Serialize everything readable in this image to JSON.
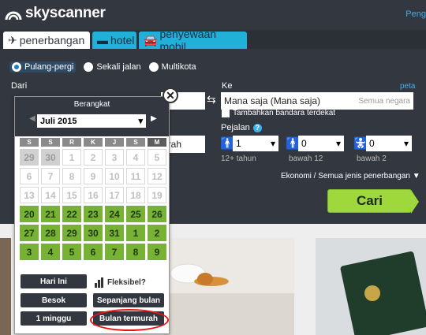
{
  "header": {
    "logo": "skyscanner",
    "top_link": "Peng"
  },
  "tabs": [
    {
      "label": "penerbangan",
      "icon": "plane-icon",
      "active": true
    },
    {
      "label": "hotel",
      "icon": "bed-icon",
      "active": false
    },
    {
      "label": "penyewaan mobil",
      "icon": "car-icon",
      "active": false
    }
  ],
  "trip_type": [
    {
      "label": "Pulang-pergi",
      "selected": true
    },
    {
      "label": "Sekali jalan",
      "selected": false
    },
    {
      "label": "Multikota",
      "selected": false
    }
  ],
  "form": {
    "from_label": "Dari",
    "to_label": "Ke",
    "map_link": "peta",
    "to_value": "Mana saja (Mana saja)",
    "to_placeholder": "Semua negara",
    "nearby_airports": "Tambahkan bandara terdekat",
    "return_value_fragment": "urah",
    "passengers_label": "Pejalan",
    "help": "?",
    "adults": {
      "value": "1",
      "note": "12+ tahun"
    },
    "children": {
      "value": "0",
      "note": "bawah 12"
    },
    "infants": {
      "value": "0",
      "note": "bawah 2"
    },
    "cabin": "Ekonomi / Semua jenis penerbangan ▼",
    "search_button": "Cari"
  },
  "calendar": {
    "title": "Berangkat",
    "month": "Juli 2015",
    "weekdays": [
      "S",
      "S",
      "R",
      "K",
      "J",
      "S",
      "M"
    ],
    "rows": [
      [
        {
          "d": "29",
          "s": "prev"
        },
        {
          "d": "30",
          "s": "prev"
        },
        {
          "d": "1",
          "s": "past"
        },
        {
          "d": "2",
          "s": "past"
        },
        {
          "d": "3",
          "s": "past"
        },
        {
          "d": "4",
          "s": "past"
        },
        {
          "d": "5",
          "s": "past"
        }
      ],
      [
        {
          "d": "6",
          "s": "past"
        },
        {
          "d": "7",
          "s": "past"
        },
        {
          "d": "8",
          "s": "past"
        },
        {
          "d": "9",
          "s": "past"
        },
        {
          "d": "10",
          "s": "past"
        },
        {
          "d": "11",
          "s": "past"
        },
        {
          "d": "12",
          "s": "past"
        }
      ],
      [
        {
          "d": "13",
          "s": "past"
        },
        {
          "d": "14",
          "s": "past"
        },
        {
          "d": "15",
          "s": "past"
        },
        {
          "d": "16",
          "s": "past"
        },
        {
          "d": "17",
          "s": "past"
        },
        {
          "d": "18",
          "s": "past"
        },
        {
          "d": "19",
          "s": "past"
        }
      ],
      [
        {
          "d": "20",
          "s": "avail"
        },
        {
          "d": "21",
          "s": "avail"
        },
        {
          "d": "22",
          "s": "avail"
        },
        {
          "d": "23",
          "s": "avail"
        },
        {
          "d": "24",
          "s": "avail"
        },
        {
          "d": "25",
          "s": "avail"
        },
        {
          "d": "26",
          "s": "avail"
        }
      ],
      [
        {
          "d": "27",
          "s": "avail"
        },
        {
          "d": "28",
          "s": "avail"
        },
        {
          "d": "29",
          "s": "avail"
        },
        {
          "d": "30",
          "s": "avail"
        },
        {
          "d": "31",
          "s": "avail"
        },
        {
          "d": "1",
          "s": "avail"
        },
        {
          "d": "2",
          "s": "avail"
        }
      ],
      [
        {
          "d": "3",
          "s": "avail"
        },
        {
          "d": "4",
          "s": "avail"
        },
        {
          "d": "5",
          "s": "avail"
        },
        {
          "d": "6",
          "s": "avail"
        },
        {
          "d": "7",
          "s": "avail"
        },
        {
          "d": "8",
          "s": "avail"
        },
        {
          "d": "9",
          "s": "avail"
        }
      ]
    ],
    "flexible_label": "Fleksibel?",
    "today": "Hari Ini",
    "tomorrow": "Besok",
    "one_week": "1 minggu",
    "whole_month": "Sepanjang bulan",
    "cheapest_month": "Bulan termurah"
  },
  "colors": {
    "accent": "#21b0d7",
    "available_day": "#78b234",
    "search": "#9ed83c",
    "highlight_ring": "#e11111"
  }
}
